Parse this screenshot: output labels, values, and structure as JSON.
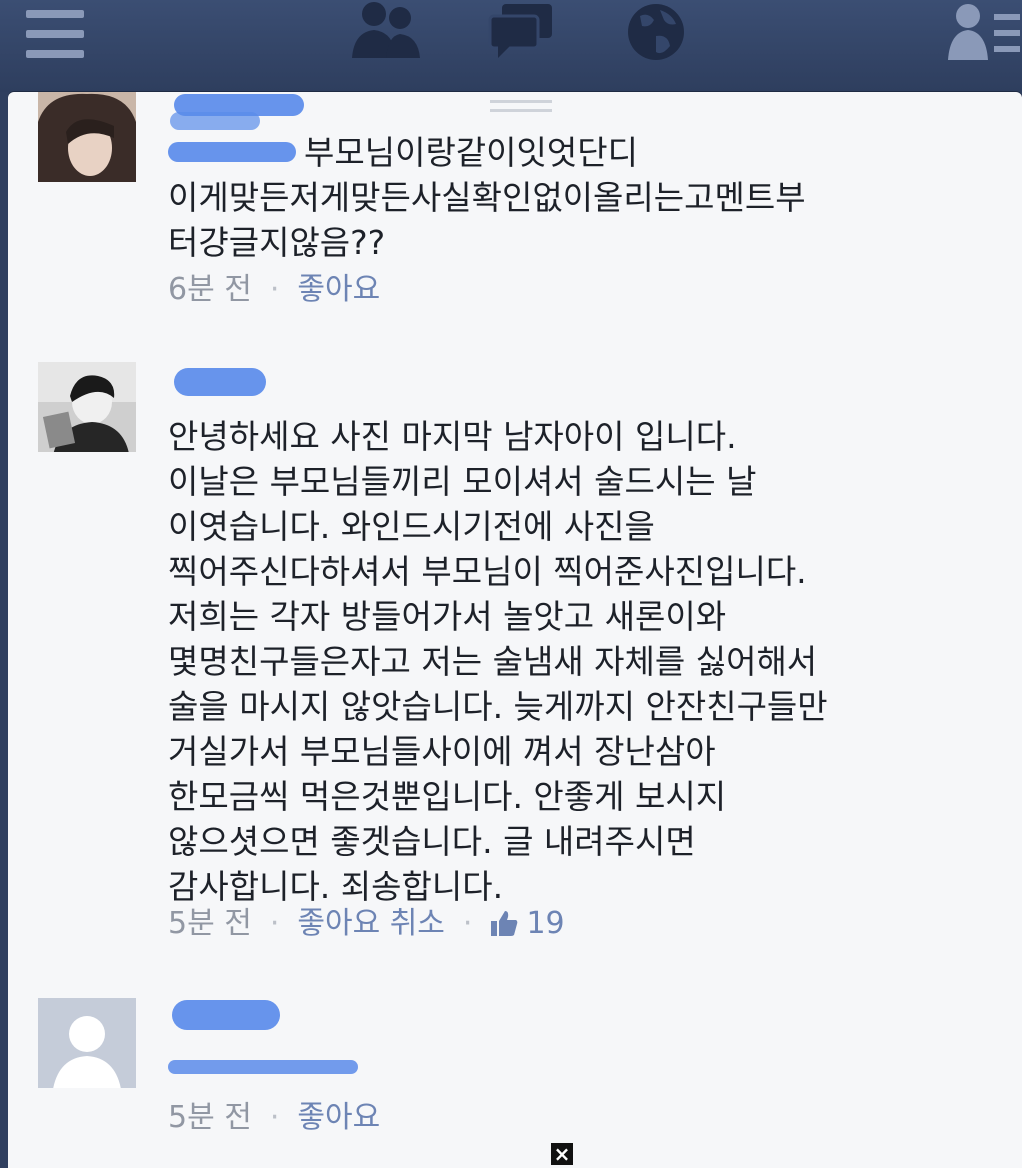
{
  "topbar": {
    "icons": [
      "menu-icon",
      "friend-requests-icon",
      "messages-icon",
      "notifications-globe-icon",
      "friends-list-icon"
    ]
  },
  "comments": [
    {
      "avatar": "avatar-girl",
      "text": "부모님이랑같이잇엇단디\n이게맞든저게맞든사실확인없이올리는고멘트부\n터걍글지않음??",
      "time": "6분 전",
      "like_label": "좋아요"
    },
    {
      "avatar": "avatar-boy",
      "text": "안녕하세요 사진 마지막 남자아이 입니다.\n이날은 부모님들끼리 모이셔서 술드시는 날\n이엿습니다. 와인드시기전에 사진을\n찍어주신다하셔서 부모님이 찍어준사진입니다.\n저희는 각자 방들어가서 놀앗고 새론이와\n몇명친구들은자고 저는 술냄새 자체를 싫어해서\n술을 마시지 않앗습니다. 늦게까지 안잔친구들만\n거실가서 부모님들사이에 껴서 장난삼아\n한모금씩 먹은것뿐입니다. 안좋게 보시지\n않으셧으면 좋겟습니다. 글 내려주시면\n감사합니다. 죄송합니다.",
      "time": "5분 전",
      "like_label": "좋아요 취소",
      "like_count": "19"
    },
    {
      "avatar": "avatar-default",
      "text": "",
      "time": "5분 전",
      "like_label": "좋아요"
    }
  ],
  "separator": "·",
  "close_label": "×",
  "colors": {
    "topbar": "#3b4e73",
    "link": "#6d84b4",
    "meta": "#9197a3",
    "redaction": "#5a8bea"
  }
}
